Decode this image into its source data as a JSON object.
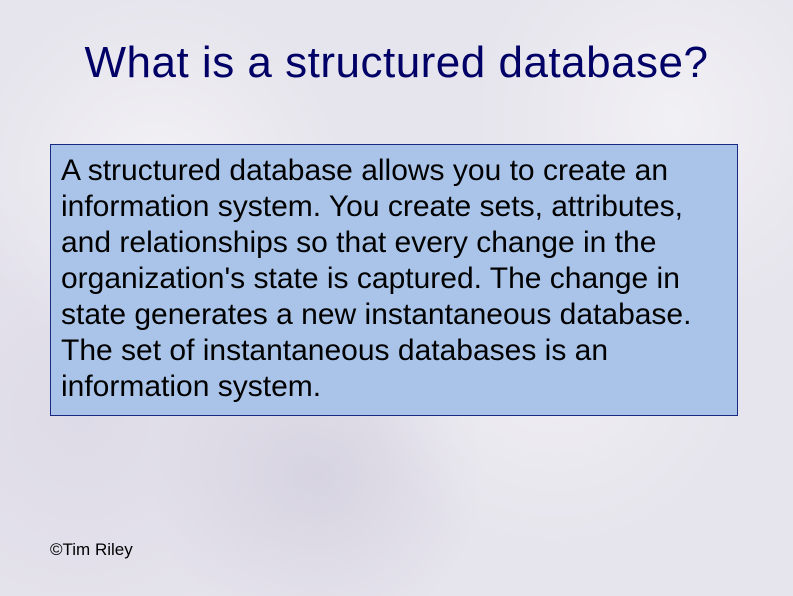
{
  "slide": {
    "title": "What is a structured database?",
    "body": "A structured database allows you to create an information system. You create sets, attributes, and relationships so that every change in the organization's state is captured. The change in state generates a new instantaneous database. The set of instantaneous databases is an information system.",
    "copyright": "©Tim Riley"
  }
}
